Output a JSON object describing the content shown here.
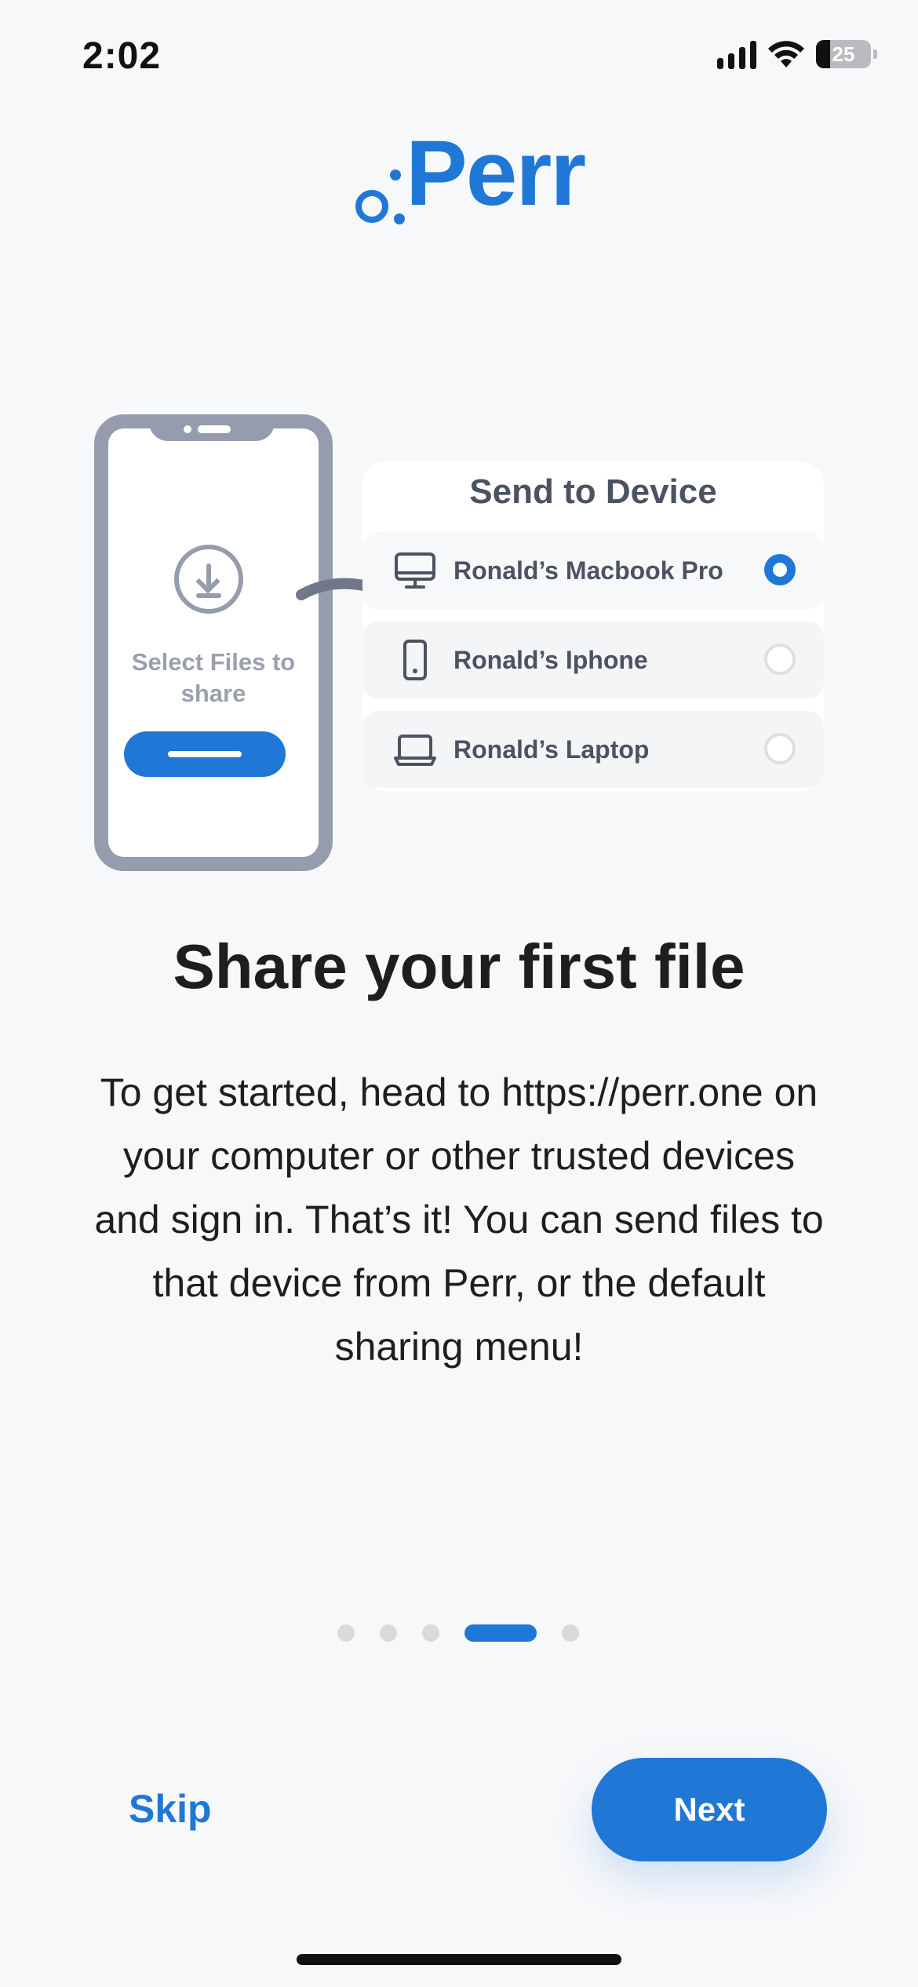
{
  "status_bar": {
    "time": "2:02",
    "battery": "25"
  },
  "logo": {
    "text": "Perr"
  },
  "illustration": {
    "phone_label": "Select Files to share",
    "card_title": "Send to Device",
    "devices": [
      {
        "name": "Ronald’s Macbook Pro",
        "icon": "desktop-icon",
        "selected": true
      },
      {
        "name": "Ronald’s Iphone",
        "icon": "phone-icon",
        "selected": false
      },
      {
        "name": "Ronald’s Laptop",
        "icon": "laptop-icon",
        "selected": false
      }
    ]
  },
  "headline": "Share your first file",
  "body": "To get started, head to https://perr.one on your computer or other trusted devices and sign in. That’s it! You can send files to that device from Perr, or the default sharing menu!",
  "pagination": {
    "total": 5,
    "current": 4
  },
  "actions": {
    "skip_label": "Skip",
    "next_label": "Next"
  },
  "colors": {
    "accent": "#1F77D6",
    "muted": "#959CAE",
    "background": "#F7F8FA"
  }
}
